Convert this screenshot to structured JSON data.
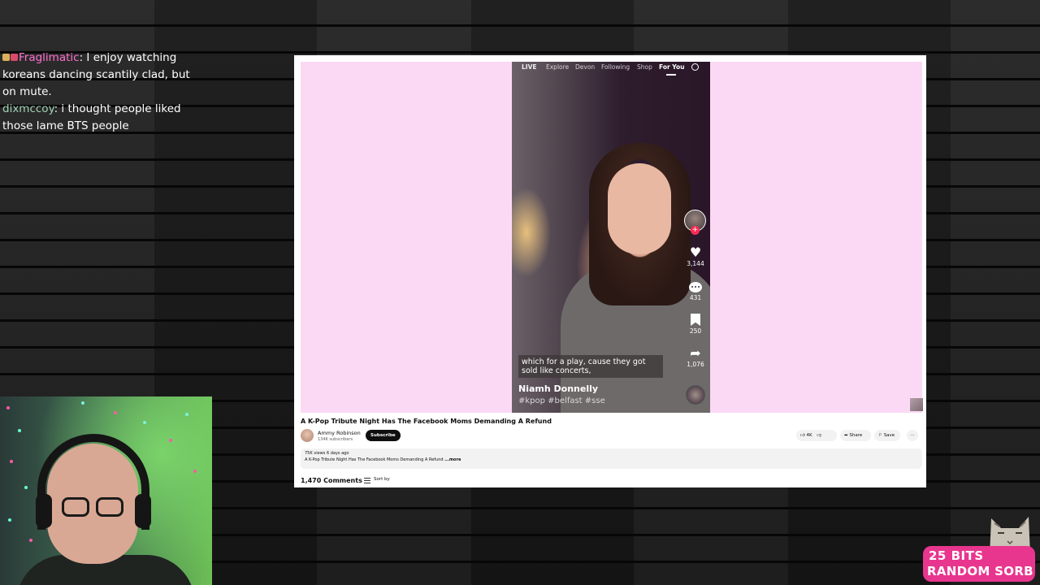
{
  "chat": {
    "messages": [
      {
        "user": "Fraglimatic",
        "color": "#ff6fd0",
        "text": "I enjoy watching koreans dancing scantily clad, but on mute.",
        "badges": true
      },
      {
        "user": "dixmccoy",
        "color": "#9fd3b4",
        "text": "i thought people liked those lame BTS people",
        "badges": false
      }
    ]
  },
  "tiktok": {
    "nav": {
      "live": "LIVE",
      "explore": "Explore",
      "devon": "Devon",
      "following": "Following",
      "shop": "Shop",
      "for_you": "For You"
    },
    "counts": {
      "likes": "3,144",
      "comments": "431",
      "saves": "250",
      "shares": "1,076"
    },
    "caption": "which for a play, cause they got sold like concerts,",
    "author": "Niamh Donnelly",
    "hashtags": "#kpop #belfast #sse"
  },
  "youtube": {
    "title": "A K-Pop Tribute Night Has The Facebook Moms Demanding A Refund",
    "channel": "Ammy Robinson",
    "subscribers": "134K subscribers",
    "subscribe_label": "Subscribe",
    "likes": "4K",
    "share_label": "Share",
    "save_label": "Save",
    "more_label": "⋯",
    "desc_meta": "75K views  6 days ago",
    "desc_text": "A K-Pop Tribute Night Has The Facebook Moms Demanding A Refund ",
    "desc_more": "...more",
    "comments_count": "1,470 Comments",
    "sort_label": "Sort by"
  },
  "alert": {
    "amount": "25 BITS",
    "name": "RANDOM SORB",
    "color": "#e8358e"
  },
  "icons": [
    "heart-icon",
    "comment-icon",
    "bookmark-icon",
    "share-icon",
    "search-icon",
    "like-icon",
    "dislike-icon",
    "sort-icon"
  ]
}
